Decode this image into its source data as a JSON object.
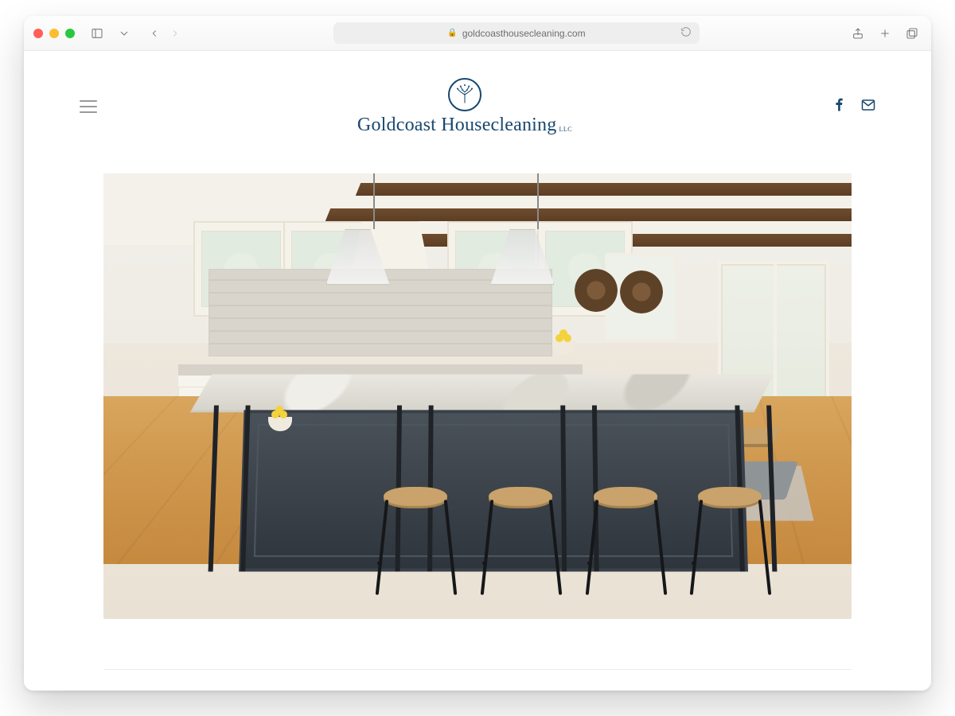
{
  "browser": {
    "url_display": "goldcoasthousecleaning.com"
  },
  "site": {
    "brand_name": "Goldcoast Housecleaning",
    "brand_suffix": "LLC"
  },
  "icons": {
    "facebook": "facebook-icon",
    "email": "email-icon",
    "menu": "menu-icon"
  },
  "colors": {
    "brand_blue": "#18486f"
  },
  "hero": {
    "alt": "Modern kitchen with large granite island, wooden stools, pendant lights and exposed ceiling beams"
  }
}
